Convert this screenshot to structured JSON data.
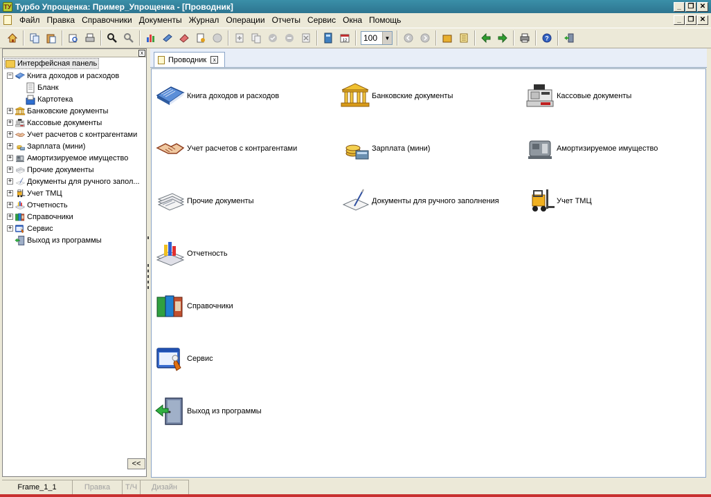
{
  "window": {
    "title": "Турбо Упрощенка: Пример_Упрощенка - [Проводник]",
    "app_icon_text": "ТУ",
    "btn_minimize": "_",
    "btn_restore": "❐",
    "btn_close": "✕"
  },
  "menu": {
    "items": [
      "Файл",
      "Правка",
      "Справочники",
      "Документы",
      "Журнал",
      "Операции",
      "Отчеты",
      "Сервис",
      "Окна",
      "Помощь"
    ]
  },
  "toolbar": {
    "zoom_value": "100",
    "icons": [
      "home-icon",
      "copy-icon",
      "paste-icon",
      "print-preview-icon",
      "print-icon",
      "find-icon",
      "find-next-icon",
      "chart-icon",
      "book-icon",
      "eraser-icon",
      "document-edit-icon",
      "cancel-icon",
      "add-icon",
      "duplicate-icon",
      "check-icon",
      "minus-icon",
      "delete-icon",
      "calculator-icon",
      "calendar-icon",
      "zoom-combo",
      "back-icon",
      "forward-icon",
      "journal-icon",
      "notes-icon",
      "arrow-left-icon",
      "arrow-right-icon",
      "printer-icon",
      "help-icon",
      "exit-icon"
    ]
  },
  "tree": {
    "root": "Интерфейсная панель",
    "items": [
      {
        "label": "Книга доходов и расходов",
        "expander": "−",
        "icon": "book-icon",
        "color": "#4a78c8"
      },
      {
        "label": "Бланк",
        "expander": "",
        "icon": "blank-doc-icon",
        "color": "#808080"
      },
      {
        "label": "Картотека",
        "expander": "",
        "icon": "card-index-icon",
        "color": "#3070d0"
      },
      {
        "label": "Банковские документы",
        "expander": "+",
        "icon": "bank-icon",
        "color": "#d8a020"
      },
      {
        "label": "Кассовые документы",
        "expander": "+",
        "icon": "cash-register-icon",
        "color": "#505050"
      },
      {
        "label": "Учет расчетов с контрагентами",
        "expander": "+",
        "icon": "handshake-icon",
        "color": "#c06030"
      },
      {
        "label": "Зарплата (мини)",
        "expander": "+",
        "icon": "salary-icon",
        "color": "#606060"
      },
      {
        "label": "Амортизируемое имущество",
        "expander": "+",
        "icon": "machine-icon",
        "color": "#707070"
      },
      {
        "label": "Прочие документы",
        "expander": "+",
        "icon": "documents-icon",
        "color": "#8090a0"
      },
      {
        "label": "Документы для ручного запол...",
        "expander": "+",
        "icon": "manual-doc-icon",
        "color": "#6080b0"
      },
      {
        "label": "Учет ТМЦ",
        "expander": "+",
        "icon": "forklift-icon",
        "color": "#e0a000"
      },
      {
        "label": "Отчетность",
        "expander": "+",
        "icon": "reports-icon",
        "color": "#4060c0"
      },
      {
        "label": "Справочники",
        "expander": "+",
        "icon": "reference-books-icon",
        "color": "#40a040"
      },
      {
        "label": "Сервис",
        "expander": "+",
        "icon": "service-icon",
        "color": "#3060c0"
      },
      {
        "label": "Выход из программы",
        "expander": "",
        "icon": "exit-door-icon",
        "color": "#40a060"
      }
    ],
    "collapse_label": "<<",
    "panel_close": "x"
  },
  "tab": {
    "label": "Проводник",
    "close": "x"
  },
  "explorer_items": [
    {
      "label": "Книга доходов и расходов",
      "icon": "book-icon"
    },
    {
      "label": "Банковские документы",
      "icon": "bank-icon"
    },
    {
      "label": "Кассовые документы",
      "icon": "cash-register-icon"
    },
    {
      "label": "Учет расчетов с контрагентами",
      "icon": "handshake-icon"
    },
    {
      "label": "Зарплата (мини)",
      "icon": "salary-icon"
    },
    {
      "label": "Амортизируемое имущество",
      "icon": "machine-icon"
    },
    {
      "label": "Прочие документы",
      "icon": "documents-icon"
    },
    {
      "label": "Документы для ручного заполнения",
      "icon": "manual-doc-icon"
    },
    {
      "label": "Учет ТМЦ",
      "icon": "forklift-icon"
    },
    {
      "label": "Отчетность",
      "icon": "reports-icon"
    },
    {
      "label": "Справочники",
      "icon": "reference-books-icon"
    },
    {
      "label": "Сервис",
      "icon": "service-icon"
    },
    {
      "label": "Выход из программы",
      "icon": "exit-door-icon"
    }
  ],
  "statusbar": {
    "tabs": [
      {
        "label": "Frame_1_1",
        "disabled": false
      },
      {
        "label": "Правка",
        "disabled": true
      },
      {
        "label": "Т/Ч",
        "disabled": true
      },
      {
        "label": "Дизайн",
        "disabled": true
      }
    ]
  }
}
